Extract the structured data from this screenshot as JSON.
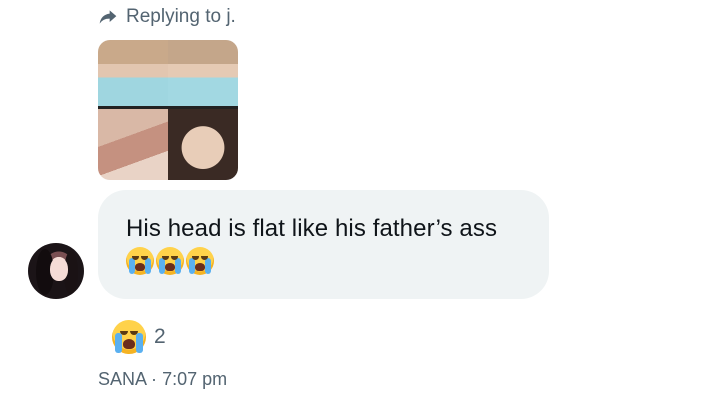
{
  "reply": {
    "label": "Replying to j."
  },
  "attachment": {
    "icon": "photo-collage"
  },
  "message": {
    "text": "His head is flat like his father’s ass",
    "emojis": [
      "😭",
      "😭",
      "😭"
    ]
  },
  "reaction": {
    "emoji": "😭",
    "count": "2"
  },
  "meta": {
    "sender": "SANA",
    "separator": "·",
    "time": "7:07 pm"
  },
  "colors": {
    "bubble": "#eff3f4",
    "muted": "#536471",
    "text": "#0f1419"
  }
}
